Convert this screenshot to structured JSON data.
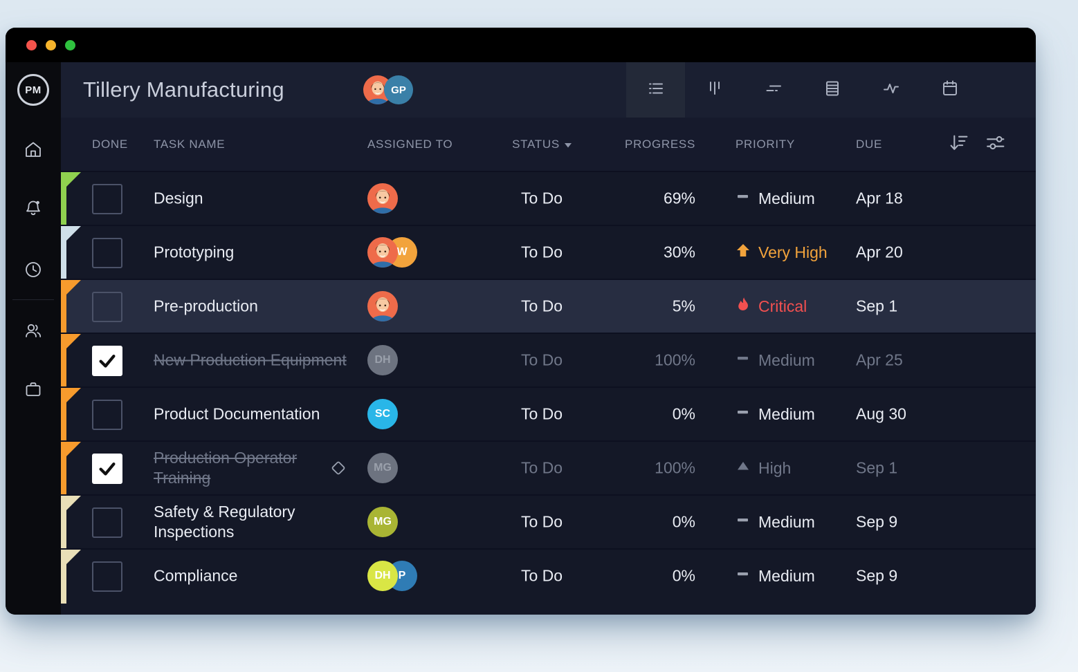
{
  "window": {
    "controls": [
      {
        "name": "close",
        "color": "#f4544c"
      },
      {
        "name": "minimize",
        "color": "#f6b42c"
      },
      {
        "name": "zoom",
        "color": "#2fc23f"
      }
    ]
  },
  "sidebar": {
    "logo_text": "PM",
    "items": [
      {
        "id": "home",
        "icon": "home-icon"
      },
      {
        "id": "notifications",
        "icon": "bell-icon",
        "badge": true
      },
      {
        "id": "history",
        "icon": "clock-icon"
      },
      {
        "id": "team",
        "icon": "users-icon"
      },
      {
        "id": "portfolio",
        "icon": "briefcase-icon"
      }
    ]
  },
  "header": {
    "title": "Tillery Manufacturing",
    "members": [
      {
        "type": "photo",
        "icon": "person-photo-avatar"
      },
      {
        "type": "initials",
        "initials": "GP",
        "color": "#3a80a8"
      }
    ],
    "views": [
      {
        "id": "list",
        "icon": "list-view-icon",
        "selected": true
      },
      {
        "id": "kanban",
        "icon": "kanban-view-icon",
        "selected": false
      },
      {
        "id": "gantt",
        "icon": "gantt-view-icon",
        "selected": false
      },
      {
        "id": "sheet",
        "icon": "sheet-view-icon",
        "selected": false
      },
      {
        "id": "activity",
        "icon": "activity-view-icon",
        "selected": false
      },
      {
        "id": "calendar",
        "icon": "calendar-view-icon",
        "selected": false
      }
    ]
  },
  "table": {
    "columns": {
      "done": "DONE",
      "task": "TASK NAME",
      "assigned": "ASSIGNED TO",
      "status": "STATUS",
      "progress": "PROGRESS",
      "priority": "PRIORITY",
      "due": "DUE"
    },
    "status_has_dropdown": true,
    "header_icons": [
      "sort-descending-icon",
      "filter-sliders-icon"
    ],
    "priority_colors": {
      "Medium": "#9aa0ae",
      "Very High": "#f2a33c",
      "Critical": "#f25050",
      "High": "#9aa0ae"
    },
    "rows": [
      {
        "task": "Design",
        "done": false,
        "completed": false,
        "highlighted": false,
        "milestone": false,
        "flag_color": "#8fd14f",
        "avatars": [
          {
            "type": "photo",
            "icon": "person-photo-avatar"
          }
        ],
        "status": "To Do",
        "progress": "69%",
        "priority": {
          "label": "Medium",
          "icon": "dash-icon"
        },
        "due": "Apr 18"
      },
      {
        "task": "Prototyping",
        "done": false,
        "completed": false,
        "highlighted": false,
        "milestone": false,
        "flag_color": "#cfdfe9",
        "avatars": [
          {
            "type": "photo",
            "icon": "person-photo-avatar"
          },
          {
            "type": "initials",
            "initials": "W",
            "color": "#f2a33c"
          }
        ],
        "status": "To Do",
        "progress": "30%",
        "priority": {
          "label": "Very High",
          "icon": "arrow-up-icon"
        },
        "due": "Apr 20"
      },
      {
        "task": "Pre-production",
        "done": false,
        "completed": false,
        "highlighted": true,
        "milestone": false,
        "flag_color": "#f79b2d",
        "avatars": [
          {
            "type": "photo",
            "icon": "person-photo-avatar"
          }
        ],
        "status": "To Do",
        "progress": "5%",
        "priority": {
          "label": "Critical",
          "icon": "flame-icon"
        },
        "due": "Sep 1"
      },
      {
        "task": "New Production Equipment",
        "done": true,
        "completed": true,
        "highlighted": false,
        "milestone": false,
        "flag_color": "#f79b2d",
        "avatars": [
          {
            "type": "initials",
            "initials": "DH",
            "color": "#6d7380",
            "text_color": "#9aa0ab"
          }
        ],
        "status": "To Do",
        "progress": "100%",
        "priority": {
          "label": "Medium",
          "icon": "dash-icon"
        },
        "due": "Apr 25"
      },
      {
        "task": "Product Documentation",
        "done": false,
        "completed": false,
        "highlighted": false,
        "milestone": false,
        "flag_color": "#f79b2d",
        "avatars": [
          {
            "type": "initials",
            "initials": "SC",
            "color": "#29b6e8"
          }
        ],
        "status": "To Do",
        "progress": "0%",
        "priority": {
          "label": "Medium",
          "icon": "dash-icon"
        },
        "due": "Aug 30"
      },
      {
        "task": "Production Operator Training",
        "done": true,
        "completed": true,
        "highlighted": false,
        "milestone": true,
        "flag_color": "#f79b2d",
        "avatars": [
          {
            "type": "initials",
            "initials": "MG",
            "color": "#6d7380",
            "text_color": "#9aa0ab"
          }
        ],
        "status": "To Do",
        "progress": "100%",
        "priority": {
          "label": "High",
          "icon": "triangle-up-icon"
        },
        "due": "Sep 1"
      },
      {
        "task": "Safety & Regulatory Inspections",
        "done": false,
        "completed": false,
        "highlighted": false,
        "milestone": false,
        "flag_color": "#e9dfb7",
        "avatars": [
          {
            "type": "initials",
            "initials": "MG",
            "color": "#a9b534"
          }
        ],
        "status": "To Do",
        "progress": "0%",
        "priority": {
          "label": "Medium",
          "icon": "dash-icon"
        },
        "due": "Sep 9"
      },
      {
        "task": "Compliance",
        "done": false,
        "completed": false,
        "highlighted": false,
        "milestone": false,
        "flag_color": "#e9dfb7",
        "avatars": [
          {
            "type": "initials",
            "initials": "DH",
            "color": "#d9e645"
          },
          {
            "type": "initials",
            "initials": "P",
            "color": "#2f7cb5"
          }
        ],
        "status": "To Do",
        "progress": "0%",
        "priority": {
          "label": "Medium",
          "icon": "dash-icon"
        },
        "due": "Sep 9"
      }
    ]
  }
}
